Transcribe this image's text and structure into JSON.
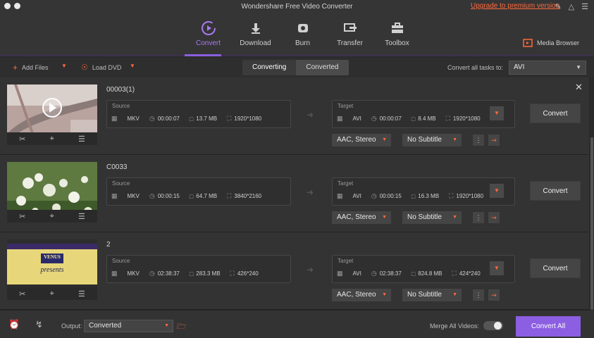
{
  "titlebar": {
    "title": "Wondershare Free Video Converter",
    "upgrade_link": "Upgrade to premium version"
  },
  "nav": {
    "items": [
      {
        "label": "Convert",
        "icon": "convert-icon"
      },
      {
        "label": "Download",
        "icon": "download-icon"
      },
      {
        "label": "Burn",
        "icon": "burn-disc-icon"
      },
      {
        "label": "Transfer",
        "icon": "transfer-icon"
      },
      {
        "label": "Toolbox",
        "icon": "toolbox-icon"
      }
    ],
    "active": "Convert",
    "media_browser": "Media Browser"
  },
  "toolbar": {
    "add_files": "Add Files",
    "load_dvd": "Load DVD",
    "tabs": [
      "Converting",
      "Converted"
    ],
    "convert_all_label": "Convert all tasks to:",
    "convert_all_format": "AVI"
  },
  "files": [
    {
      "name": "00003(1)",
      "source": {
        "label": "Source",
        "format": "MKV",
        "duration": "00:00:07",
        "size": "13.7 MB",
        "resolution": "1920*1080"
      },
      "target": {
        "label": "Target",
        "format": "AVI",
        "duration": "00:00:07",
        "size": "8.4 MB",
        "resolution": "1920*1080"
      },
      "audio": "AAC, Stereo",
      "subtitle": "No Subtitle",
      "convert": "Convert"
    },
    {
      "name": "C0033",
      "source": {
        "label": "Source",
        "format": "MKV",
        "duration": "00:00:15",
        "size": "64.7 MB",
        "resolution": "3840*2160"
      },
      "target": {
        "label": "Target",
        "format": "AVI",
        "duration": "00:00:15",
        "size": "16.3 MB",
        "resolution": "1920*1080"
      },
      "audio": "AAC, Stereo",
      "subtitle": "No Subtitle",
      "convert": "Convert"
    },
    {
      "name": "2",
      "source": {
        "label": "Source",
        "format": "MKV",
        "duration": "02:38:37",
        "size": "283.3 MB",
        "resolution": "426*240"
      },
      "target": {
        "label": "Target",
        "format": "AVI",
        "duration": "02:38:37",
        "size": "824.8 MB",
        "resolution": "424*240"
      },
      "audio": "AAC, Stereo",
      "subtitle": "No Subtitle",
      "convert": "Convert",
      "thumb_text": {
        "logo": "VENUS",
        "caption": "presents"
      }
    }
  ],
  "bottom": {
    "output_label": "Output:",
    "output_value": "Converted",
    "merge_label": "Merge All Videos:",
    "merge_on": false,
    "convert_all": "Convert All"
  },
  "colors": {
    "accent": "#8b5ee2",
    "highlight": "#ff6a3d",
    "background": "#2b2b2b"
  }
}
